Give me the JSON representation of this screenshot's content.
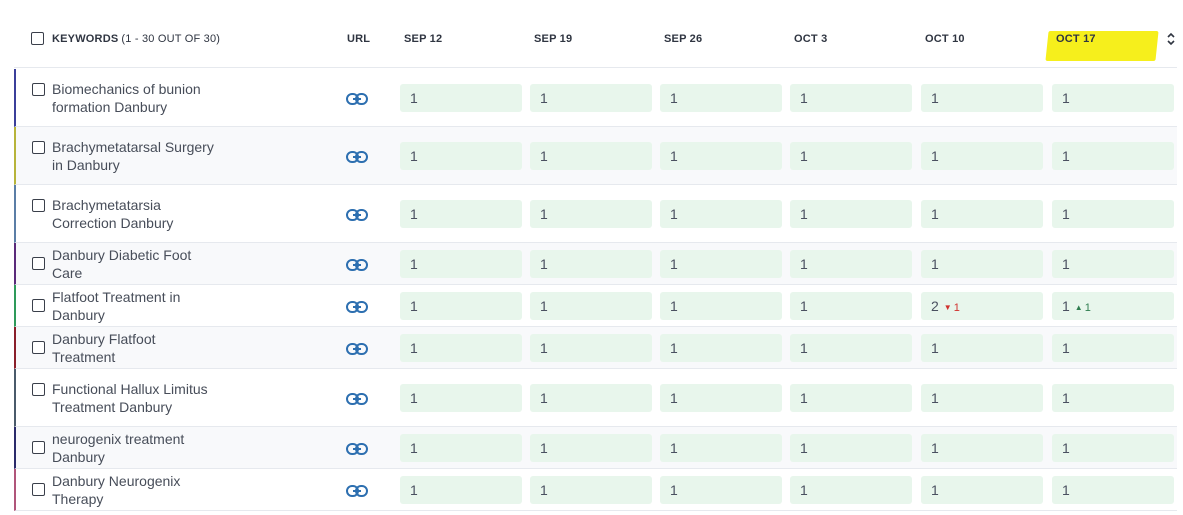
{
  "header": {
    "keywords_label": "KEYWORDS",
    "range": "(1 - 30 OUT OF 30)",
    "url_label": "URL",
    "columns": [
      "SEP 12",
      "SEP 19",
      "SEP 26",
      "OCT 3",
      "OCT 10",
      "OCT 17"
    ]
  },
  "colors": {
    "highlight": "#f6ef1c",
    "value_bg": "#e8f6ec",
    "link_icon": "#2d6fb0",
    "down": "#d0312d",
    "up": "#2e7d4f"
  },
  "rows": [
    {
      "keyword": "Biomechanics of bunion formation Danbury",
      "accent": "#3b3f9a",
      "values": [
        "1",
        "1",
        "1",
        "1",
        "1",
        "1"
      ]
    },
    {
      "keyword": "Brachymetatarsal Surgery in Danbury",
      "accent": "#b7b43a",
      "values": [
        "1",
        "1",
        "1",
        "1",
        "1",
        "1"
      ]
    },
    {
      "keyword": "Brachymetatarsia Correction Danbury",
      "accent": "#5b7ea6",
      "values": [
        "1",
        "1",
        "1",
        "1",
        "1",
        "1"
      ]
    },
    {
      "keyword": "Danbury Diabetic Foot Care",
      "accent": "#5a2a7a",
      "values": [
        "1",
        "1",
        "1",
        "1",
        "1",
        "1"
      ]
    },
    {
      "keyword": "Flatfoot Treatment in Danbury",
      "accent": "#2e9a5a",
      "values": [
        "1",
        "1",
        "1",
        "1",
        "2",
        "1"
      ],
      "changes": {
        "4": {
          "dir": "down",
          "text": "1"
        },
        "5": {
          "dir": "up",
          "text": "1"
        }
      }
    },
    {
      "keyword": "Danbury Flatfoot Treatment",
      "accent": "#8a1f2a",
      "values": [
        "1",
        "1",
        "1",
        "1",
        "1",
        "1"
      ]
    },
    {
      "keyword": "Functional Hallux Limitus Treatment Danbury",
      "accent": "#4a5a6a",
      "values": [
        "1",
        "1",
        "1",
        "1",
        "1",
        "1"
      ]
    },
    {
      "keyword": "neurogenix treatment Danbury",
      "accent": "#2a2a6a",
      "values": [
        "1",
        "1",
        "1",
        "1",
        "1",
        "1"
      ]
    },
    {
      "keyword": "Danbury Neurogenix Therapy",
      "accent": "#b0557a",
      "values": [
        "1",
        "1",
        "1",
        "1",
        "1",
        "1"
      ]
    }
  ]
}
